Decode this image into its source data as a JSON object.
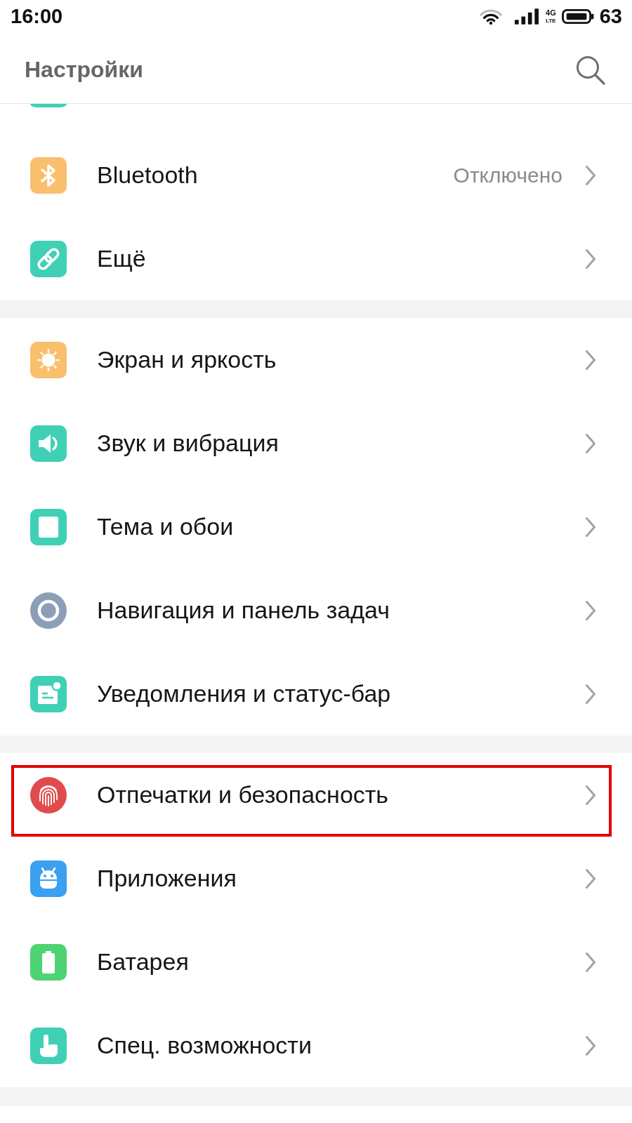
{
  "status_bar": {
    "time": "16:00",
    "network": "4G",
    "network_sub": "LTE",
    "battery": "63"
  },
  "header": {
    "title": "Настройки"
  },
  "sections": [
    {
      "items": [
        {
          "label": "Bluetooth",
          "value": "Отключено",
          "highlighted": false
        },
        {
          "label": "Ещё",
          "highlighted": false
        }
      ]
    },
    {
      "items": [
        {
          "label": "Экран и яркость",
          "highlighted": false
        },
        {
          "label": "Звук и вибрация",
          "highlighted": false
        },
        {
          "label": "Тема и обои",
          "highlighted": false
        },
        {
          "label": "Навигация и панель задач",
          "highlighted": false
        },
        {
          "label": "Уведомления и статус-бар",
          "highlighted": false
        }
      ]
    },
    {
      "items": [
        {
          "label": "Отпечатки и безопасность",
          "highlighted": true
        },
        {
          "label": "Приложения",
          "highlighted": false
        },
        {
          "label": "Батарея",
          "highlighted": false
        },
        {
          "label": "Спец. возможности",
          "highlighted": false
        }
      ]
    }
  ]
}
